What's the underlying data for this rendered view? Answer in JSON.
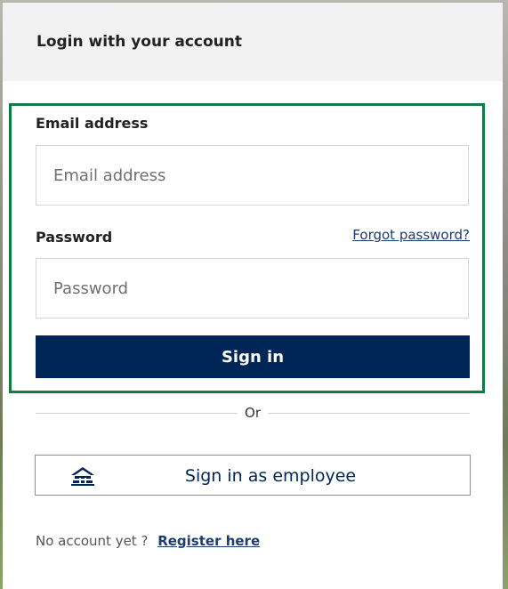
{
  "card": {
    "title": "Login with your account"
  },
  "form": {
    "email_label": "Email address",
    "email_placeholder": "Email address",
    "password_label": "Password",
    "password_placeholder": "Password",
    "forgot_link": "Forgot password?",
    "signin_label": "Sign in"
  },
  "divider": {
    "text": "Or"
  },
  "employee": {
    "label": "Sign in as employee",
    "icon": "building-icon"
  },
  "register": {
    "prompt": "No account yet ?",
    "link": "Register here"
  },
  "colors": {
    "primary": "#002657",
    "focus_border": "#117a45",
    "link": "#1a3e6e"
  }
}
